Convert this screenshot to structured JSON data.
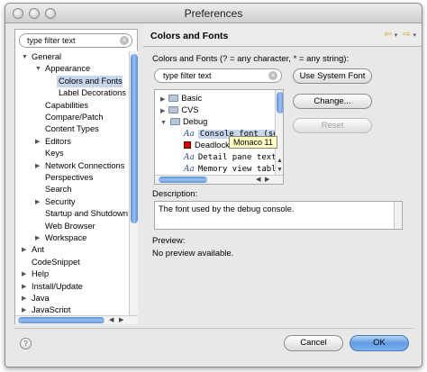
{
  "window": {
    "title": "Preferences"
  },
  "sidebar": {
    "filter_placeholder": "type filter text",
    "items": [
      {
        "label": "General",
        "expand": "open"
      },
      {
        "label": "Appearance",
        "expand": "open"
      },
      {
        "label": "Colors and Fonts",
        "expand": "none",
        "selected": true
      },
      {
        "label": "Label Decorations",
        "expand": "none"
      },
      {
        "label": "Capabilities",
        "expand": "none"
      },
      {
        "label": "Compare/Patch",
        "expand": "none"
      },
      {
        "label": "Content Types",
        "expand": "none"
      },
      {
        "label": "Editors",
        "expand": "closed"
      },
      {
        "label": "Keys",
        "expand": "none"
      },
      {
        "label": "Network Connections",
        "expand": "closed"
      },
      {
        "label": "Perspectives",
        "expand": "none"
      },
      {
        "label": "Search",
        "expand": "none"
      },
      {
        "label": "Security",
        "expand": "closed"
      },
      {
        "label": "Startup and Shutdown",
        "expand": "none"
      },
      {
        "label": "Web Browser",
        "expand": "none"
      },
      {
        "label": "Workspace",
        "expand": "closed"
      },
      {
        "label": "Ant",
        "expand": "closed"
      },
      {
        "label": "CodeSnippet",
        "expand": "none"
      },
      {
        "label": "Help",
        "expand": "closed"
      },
      {
        "label": "Install/Update",
        "expand": "closed"
      },
      {
        "label": "Java",
        "expand": "closed"
      },
      {
        "label": "JavaScript",
        "expand": "closed"
      }
    ]
  },
  "page": {
    "title": "Colors and Fonts",
    "hint": "Colors and Fonts (? = any character, * = any string):",
    "filter_placeholder": "type filter text",
    "buttons": {
      "use_system_font": "Use System Font",
      "change": "Change...",
      "reset": "Reset"
    },
    "fonts_tree": [
      {
        "label": "Basic",
        "kind": "folder",
        "expand": "closed"
      },
      {
        "label": "CVS",
        "kind": "folder",
        "expand": "closed"
      },
      {
        "label": "Debug",
        "kind": "folder",
        "expand": "open"
      },
      {
        "label": "Console font (se",
        "kind": "font",
        "selected": true
      },
      {
        "label": "Deadlock",
        "kind": "color"
      },
      {
        "label": "Detail pane text",
        "kind": "font"
      },
      {
        "label": "Memory view tabl",
        "kind": "font"
      }
    ],
    "tooltip": "Monaco 11",
    "description_label": "Description:",
    "description": "The font used by the debug console.",
    "preview_label": "Preview:",
    "preview": "No preview available."
  },
  "footer": {
    "help_icon": "?",
    "cancel": "Cancel",
    "ok": "OK"
  },
  "colors": {
    "selection": "#c7d6ec",
    "primary_button": "#5f9be4",
    "nav_arrow": "#d4a017",
    "deadlock_swatch": "#d40000"
  }
}
